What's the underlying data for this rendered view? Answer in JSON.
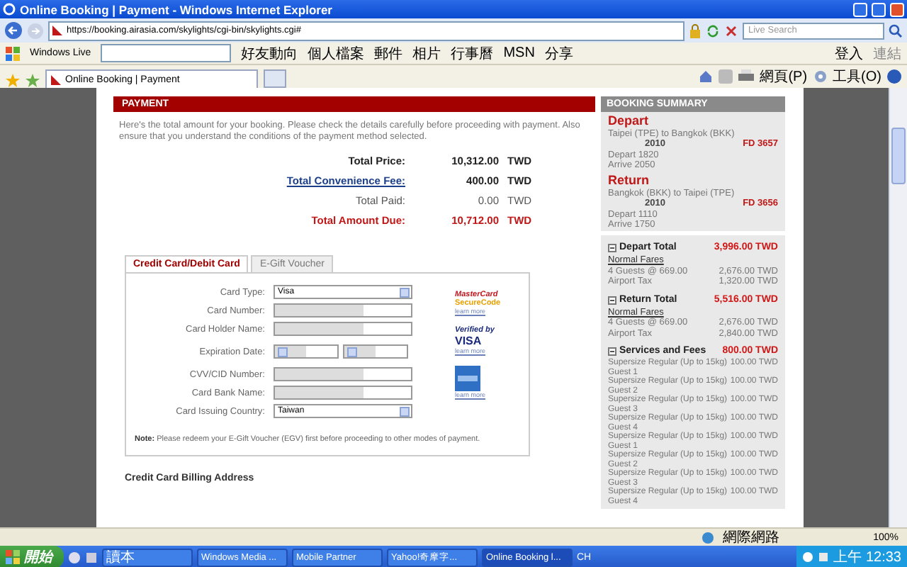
{
  "window": {
    "title": "Online Booking | Payment - Windows Internet Explorer"
  },
  "address_bar": {
    "url": "https://booking.airasia.com/skylights/cgi-bin/skylights.cgi#",
    "search_placeholder": "Live Search"
  },
  "links_toolbar": {
    "brand": "Windows Live",
    "links": [
      "好友動向",
      "個人檔案",
      "郵件",
      "相片",
      "行事曆",
      "MSN",
      "分享"
    ],
    "sign_in": "登入",
    "links_label": "連結"
  },
  "tabs": [
    {
      "label": "Online Booking | Payment",
      "selected": true
    }
  ],
  "command_bar": {
    "page": "網頁(P)",
    "tools": "工具(O)"
  },
  "payment": {
    "heading": "PAYMENT",
    "intro": "Here's the total amount for your booking. Please check the details carefully before proceeding with payment. Also ensure that you understand the conditions of the payment method selected.",
    "totals": [
      {
        "kind": "bold",
        "label": "Total Price:",
        "amount": "10,312.00",
        "currency": "TWD"
      },
      {
        "kind": "link",
        "label": "Total Convenience Fee:",
        "amount": "400.00",
        "currency": "TWD"
      },
      {
        "kind": "plain",
        "label": "Total Paid:",
        "amount": "0.00",
        "currency": "TWD"
      },
      {
        "kind": "due",
        "label": "Total Amount Due:",
        "amount": "10,712.00",
        "currency": "TWD"
      }
    ],
    "payment_tabs": [
      {
        "label": "Credit Card/Debit Card",
        "selected": true
      },
      {
        "label": "E-Gift Voucher",
        "selected": false
      }
    ],
    "fields": [
      {
        "kind": "select",
        "label": "Card Type:",
        "value": "Visa"
      },
      {
        "kind": "text",
        "label": "Card Number:"
      },
      {
        "kind": "text",
        "label": "Card Holder Name:"
      },
      {
        "kind": "date",
        "label": "Expiration Date:"
      },
      {
        "kind": "text",
        "label": "CVV/CID Number:"
      },
      {
        "kind": "text",
        "label": "Card Bank Name:"
      },
      {
        "kind": "select",
        "label": "Card Issuing Country:",
        "value": "Taiwan"
      }
    ],
    "badges": [
      {
        "kind": "mastercard",
        "line1": "MasterCard",
        "line2": "SecureCode",
        "link": "learn more"
      },
      {
        "kind": "visa",
        "line1": "Verified by",
        "line2": "VISA",
        "link": "learn more"
      },
      {
        "kind": "amex",
        "link": "learn more"
      }
    ],
    "note": "**Note:** Please redeem your E-Gift Voucher (EGV) first before proceeding to other modes of payment.",
    "billing_heading": "Credit Card Billing Address"
  },
  "booking_summary": {
    "heading": "BOOKING SUMMARY",
    "flights": [
      {
        "title": "Depart",
        "route": "Taipei (TPE) to Bangkok (BKK)",
        "date": "2010",
        "flight": "FD 3657",
        "depart": "Depart 1820",
        "arrive": "Arrive 2050"
      },
      {
        "title": "Return",
        "route": "Bangkok (BKK) to Taipei (TPE)",
        "date": "2010",
        "flight": "FD 3656",
        "depart": "Depart 1110",
        "arrive": "Arrive 1750"
      }
    ],
    "totals": [
      {
        "title": "Depart Total",
        "amount": "3,996.00 TWD",
        "fare_label": "Normal Fares",
        "lines": [
          {
            "label": "4 Guests @ 669.00",
            "amount": "2,676.00 TWD"
          },
          {
            "label": "Airport Tax",
            "amount": "1,320.00 TWD"
          }
        ]
      },
      {
        "title": "Return Total",
        "amount": "5,516.00 TWD",
        "fare_label": "Normal Fares",
        "lines": [
          {
            "label": "4 Guests @ 669.00",
            "amount": "2,676.00 TWD"
          },
          {
            "label": "Airport Tax",
            "amount": "2,840.00 TWD"
          }
        ]
      },
      {
        "title": "Services and Fees",
        "amount": "800.00 TWD",
        "lines": [
          {
            "label": "Supersize Regular (Up to 15kg)",
            "sub": "Guest 1",
            "amount": "100.00 TWD"
          },
          {
            "label": "Supersize Regular (Up to 15kg)",
            "sub": "Guest 2",
            "amount": "100.00 TWD"
          },
          {
            "label": "Supersize Regular (Up to 15kg)",
            "sub": "Guest 3",
            "amount": "100.00 TWD"
          },
          {
            "label": "Supersize Regular (Up to 15kg)",
            "sub": "Guest 4",
            "amount": "100.00 TWD"
          },
          {
            "label": "Supersize Regular (Up to 15kg)",
            "sub": "Guest 1",
            "amount": "100.00 TWD"
          },
          {
            "label": "Supersize Regular (Up to 15kg)",
            "sub": "Guest 2",
            "amount": "100.00 TWD"
          },
          {
            "label": "Supersize Regular (Up to 15kg)",
            "sub": "Guest 3",
            "amount": "100.00 TWD"
          },
          {
            "label": "Supersize Regular (Up to 15kg)",
            "sub": "Guest 4",
            "amount": "100.00 TWD"
          }
        ]
      }
    ]
  },
  "status_bar": {
    "zone": "網際網路",
    "zoom": "100%"
  },
  "taskbar": {
    "start": "開始",
    "tasks": [
      {
        "label": "讀本",
        "selected": false
      },
      {
        "label": "Windows Media ...",
        "selected": false
      },
      {
        "label": "Mobile Partner",
        "selected": false
      },
      {
        "label": "Yahoo!奇摩字...",
        "selected": false
      },
      {
        "label": "Online Booking l...",
        "selected": true
      }
    ],
    "language": "CH",
    "clock": "上午 12:33"
  }
}
